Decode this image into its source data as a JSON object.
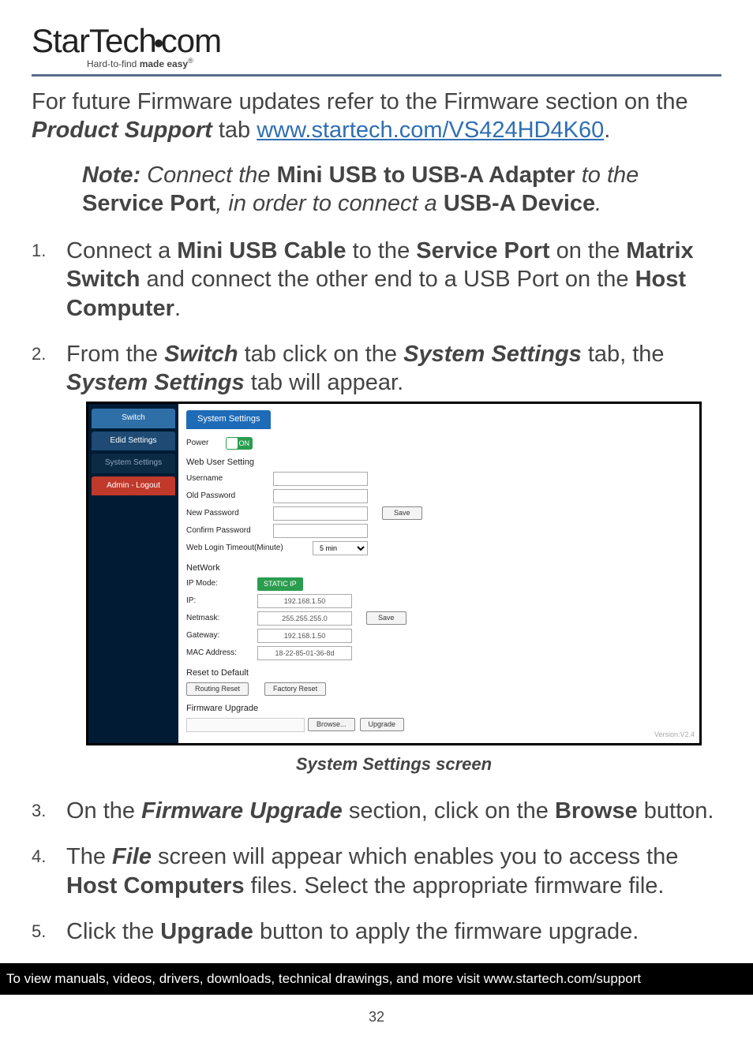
{
  "logo": {
    "text": "StarTech.com",
    "tagline_prefix": "Hard-to-find ",
    "tagline_bold": "made easy",
    "reg": "®"
  },
  "intro": {
    "pre": "For future Firmware updates refer to the Firmware section on the ",
    "product_support": "Product Support",
    "mid": " tab ",
    "link_text": "www.startech.com/VS424HD4K60",
    "tail": "."
  },
  "note": {
    "label": "Note:",
    "t1": " Connect the ",
    "b1": "Mini USB to USB-A Adapter",
    "t2": " to the ",
    "b2": "Service Port",
    "t3": ", in order to connect a ",
    "b3": "USB-A Device",
    "t4": "."
  },
  "step1": {
    "t1": "Connect a ",
    "b1": "Mini USB Cable",
    "t2": " to the ",
    "b2": "Service Port",
    "t3": " on the ",
    "b3": "Matrix Switch",
    "t4": " and connect the other end to a USB Port on the ",
    "b4": "Host Computer",
    "t5": "."
  },
  "step2": {
    "t1": "From the ",
    "bi1": "Switch",
    "t2": " tab click on the ",
    "bi2": "System Settings",
    "t3": " tab, the ",
    "bi3": "System Settings",
    "t4": " tab will appear."
  },
  "shot": {
    "sidebar": {
      "switch": "Switch",
      "edid": "Edid Settings",
      "sys": "System Settings",
      "logout": "Admin - Logout"
    },
    "tab": "System Settings",
    "power_label": "Power",
    "power_toggle": "ON",
    "webuser_title": "Web User Setting",
    "username": "Username",
    "oldpw": "Old Password",
    "newpw": "New Password",
    "confpw": "Confirm Password",
    "save": "Save",
    "timeout_label": "Web Login Timeout(Minute)",
    "timeout_val": "5 min",
    "network_title": "NetWork",
    "ipmode_label": "IP Mode:",
    "ipmode_val": "STATIC IP",
    "ip_label": "IP:",
    "ip_val": "192.168.1.50",
    "nm_label": "Netmask:",
    "nm_val": "255.255.255.0",
    "gw_label": "Gateway:",
    "gw_val": "192.168.1.50",
    "mac_label": "MAC Address:",
    "mac_val": "18-22-85-01-36-8d",
    "reset_title": "Reset to Default",
    "routing_reset": "Routing Reset",
    "factory_reset": "Factory Reset",
    "fw_title": "Firmware Upgrade",
    "browse": "Browse...",
    "upgrade": "Upgrade",
    "version": "Version:V2.4"
  },
  "caption": "System Settings screen",
  "step3": {
    "t1": "On the ",
    "bi1": "Firmware Upgrade",
    "t2": " section, click on the ",
    "b1": "Browse",
    "t3": " button."
  },
  "step4": {
    "t1": "The ",
    "bi1": "File",
    "t2": " screen will appear which enables you to access the ",
    "b1": "Host Computers",
    "t3": " files. Select the appropriate firmware file."
  },
  "step5": {
    "t1": "Click the ",
    "b1": "Upgrade",
    "t2": " button to apply the firmware upgrade."
  },
  "footer": "To view manuals, videos, drivers, downloads, technical drawings, and more visit www.startech.com/support",
  "pagenum": "32"
}
